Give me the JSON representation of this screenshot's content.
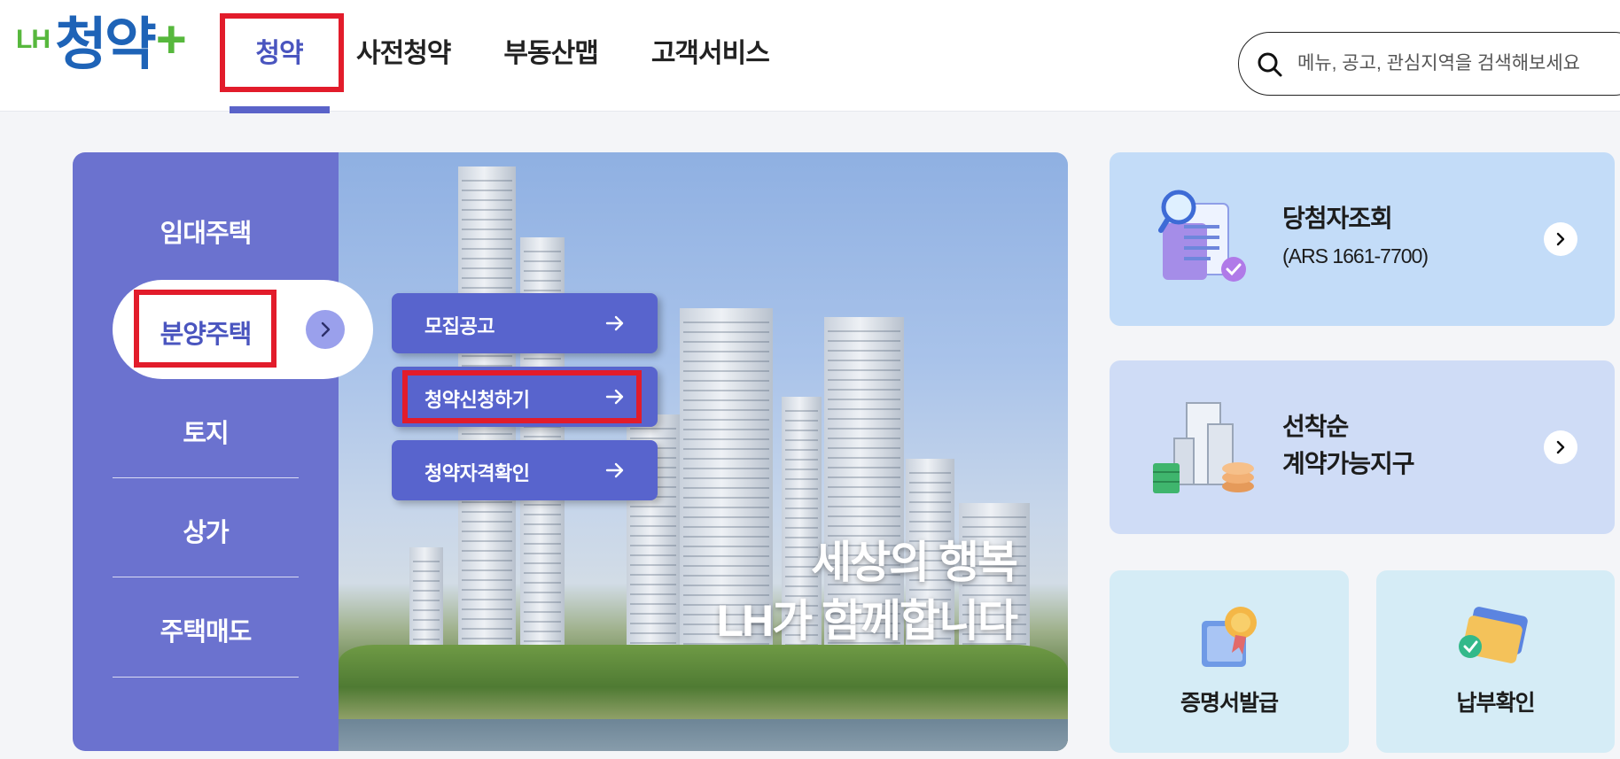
{
  "header": {
    "logo_lh": "LH",
    "logo_main": "청약",
    "logo_plus": "+",
    "nav": [
      "청약",
      "사전청약",
      "부동산맵",
      "고객서비스"
    ],
    "search_placeholder": "메뉴, 공고, 관심지역을 검색해보세요"
  },
  "sidebar": {
    "items": [
      "임대주택",
      "분양주택",
      "토지",
      "상가",
      "주택매도"
    ],
    "active_index": 1
  },
  "submenu": {
    "items": [
      "모집공고",
      "청약신청하기",
      "청약자격확인"
    ]
  },
  "banner": {
    "slogan_line1": "세상의 행복",
    "slogan_line2": "LH가 함께합니다"
  },
  "cards": {
    "winner": {
      "title": "당첨자조회",
      "subtitle": "(ARS 1661-7700)"
    },
    "first_come": {
      "title_line1": "선착순",
      "title_line2": "계약가능지구"
    },
    "certificate": {
      "label": "증명서발급"
    },
    "payment": {
      "label": "납부확인"
    }
  },
  "colors": {
    "accent": "#5a63c9",
    "sidebar": "#6b72cf",
    "highlight": "#e21c2b",
    "card_blue": "#c3dcf8",
    "card_lavender": "#cfdcf6",
    "card_light": "#d5ecf6"
  },
  "icons": [
    "search-icon",
    "arrow-right-icon",
    "chevron-right-icon",
    "magnifier-document-icon",
    "building-coins-icon",
    "certificate-medal-icon",
    "card-check-icon"
  ]
}
